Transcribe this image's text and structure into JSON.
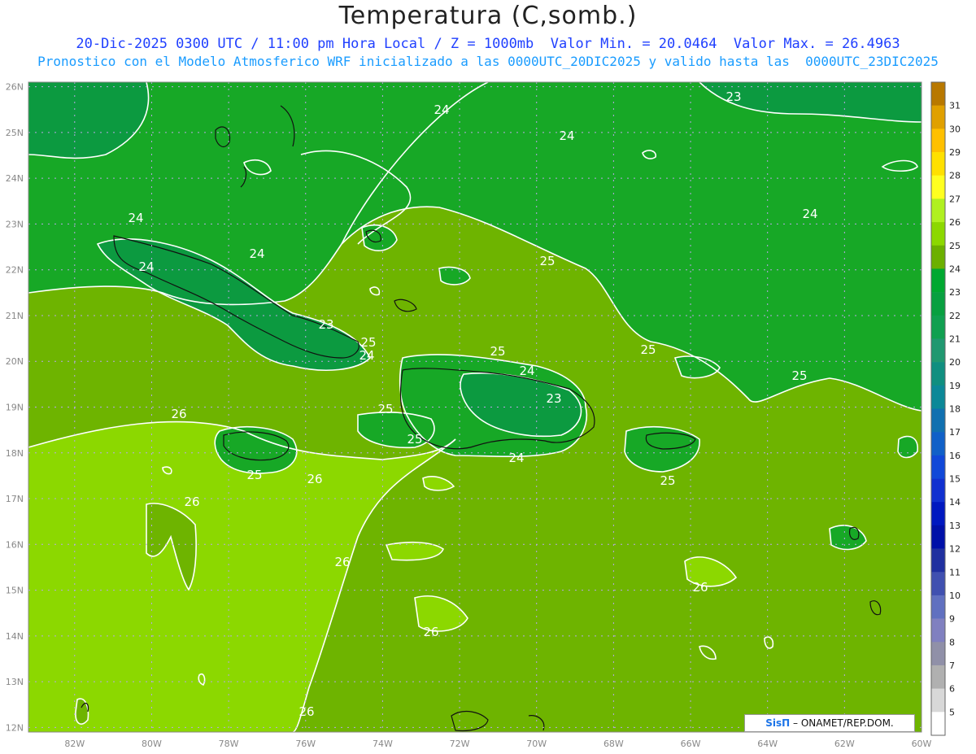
{
  "title": "Temperatura (C,somb.)",
  "subtitle_line1": "20-Dic-2025 0300 UTC / 11:00 pm Hora Local / Z = 1000mb  Valor Min. = 20.0464  Valor Max. = 26.4963",
  "subtitle_line2": "Pronostico con el Modelo Atmosferico WRF inicializado a las 0000UTC_20DIC2025 y valido hasta las  0000UTC_23DIC2025",
  "credit": {
    "brand": "SisΠ",
    "text": "– ONAMET/REP.DOM."
  },
  "map": {
    "lon_range": [
      -83.2,
      -60
    ],
    "lat_range": [
      11.9,
      26.1
    ],
    "lon_ticks": [
      "82W",
      "80W",
      "78W",
      "76W",
      "74W",
      "72W",
      "70W",
      "68W",
      "66W",
      "64W",
      "62W",
      "60W"
    ],
    "lat_ticks": [
      "26N",
      "25N",
      "24N",
      "23N",
      "22N",
      "21N",
      "20N",
      "19N",
      "18N",
      "17N",
      "16N",
      "15N",
      "14N",
      "13N",
      "12N"
    ],
    "contour_labels": [
      "24",
      "24",
      "23",
      "24",
      "24",
      "24",
      "24",
      "23",
      "25",
      "24",
      "25",
      "24",
      "23",
      "25",
      "25",
      "24",
      "25",
      "25",
      "26",
      "25",
      "26",
      "26",
      "26",
      "26",
      "26",
      "26",
      "25",
      "25"
    ]
  },
  "colorbar": {
    "labels": [
      "31",
      "30",
      "29",
      "28",
      "27",
      "26",
      "25",
      "24",
      "23",
      "22",
      "21",
      "20",
      "19",
      "18",
      "17",
      "16",
      "15",
      "14",
      "13",
      "12",
      "11",
      "10",
      "9",
      "8",
      "7",
      "6",
      "5"
    ],
    "colors": [
      "#b87800",
      "#e0a000",
      "#ffc000",
      "#ffe000",
      "#ffff20",
      "#b0f020",
      "#8cd800",
      "#6cb000",
      "#00a830",
      "#08a040",
      "#10a050",
      "#209870",
      "#108f80",
      "#0c8898",
      "#1070b0",
      "#1060c8",
      "#1048d8",
      "#1030d0",
      "#0018c0",
      "#0010a8",
      "#2030a0",
      "#4050b0",
      "#6070c0",
      "#8080c0",
      "#9090a8",
      "#b0b0b0",
      "#d8d8d8",
      "#ffffff"
    ]
  },
  "colors": {
    "c23": "#0c9a40",
    "c24": "#17a826",
    "c25": "#6eb400",
    "c26": "#8cd800",
    "frame": "#888888",
    "grid": "#b9a6e8"
  }
}
